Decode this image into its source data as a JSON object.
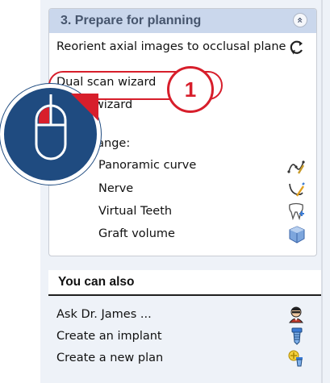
{
  "panel": {
    "title": "3. Prepare for planning",
    "collapse_symbol": "«",
    "items": [
      {
        "label": "Reorient axial images to occlusal plane",
        "icon": "reorient-icon"
      },
      {
        "label": "Dual scan wizard"
      },
      {
        "label": "l scan wizard"
      },
      {
        "label": "e or change:"
      },
      {
        "label": "Panoramic curve",
        "icon": "panoramic-curve-icon"
      },
      {
        "label": "Nerve",
        "icon": "nerve-icon"
      },
      {
        "label": "Virtual Teeth",
        "icon": "virtual-teeth-icon"
      },
      {
        "label": "Graft volume",
        "icon": "graft-volume-icon"
      }
    ]
  },
  "also": {
    "title": "You can also",
    "items": [
      {
        "label": "Ask Dr. James ...",
        "icon": "doctor-icon"
      },
      {
        "label": "Create an implant",
        "icon": "implant-icon"
      },
      {
        "label": "Create a new plan",
        "icon": "new-plan-icon"
      }
    ]
  },
  "callout": {
    "step_number": "1",
    "mouse_icon": "mouse-left-click-icon"
  },
  "colors": {
    "accent_red": "#d71e2b",
    "mouse_blue": "#1f4b80",
    "header_blue": "#cad7ec"
  }
}
